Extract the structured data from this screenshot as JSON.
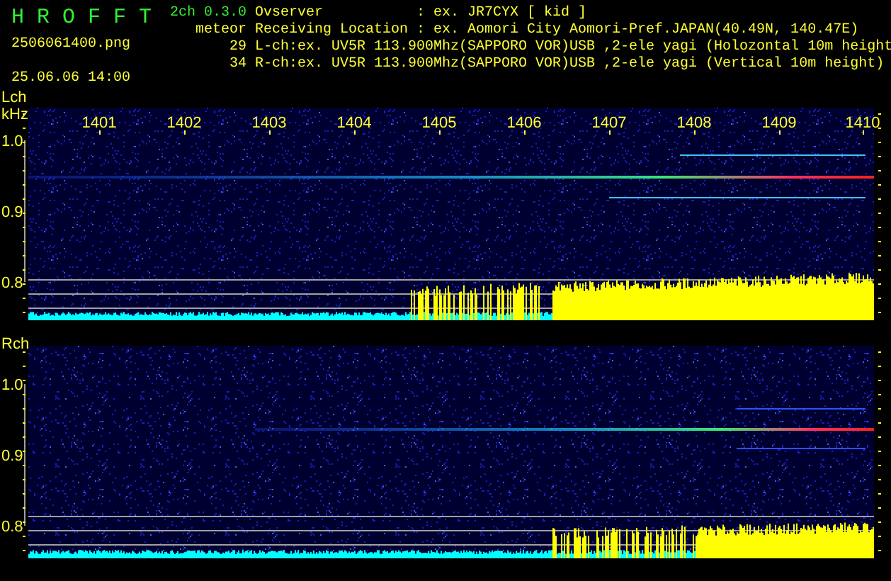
{
  "header": {
    "app_title": "H R O F F T",
    "version": "2ch 0.3.0",
    "filename": "2506061400.png",
    "datetime": "25.06.06 14:00",
    "meteor_label": "meteor",
    "meteor_counts": [
      "29",
      "34"
    ],
    "info_lines": [
      "Ovserver           : ex. JR7CYX [ kid ]",
      "Receiving Location : ex. Aomori City Aomori-Pref.JAPAN(40.49N, 140.47E)",
      "L-ch:ex. UV5R 113.900Mhz(SAPPORO VOR)USB ,2-ele yagi (Holozontal 10m height",
      "R-ch:ex. UV5R 113.900Mhz(SAPPORO VOR)USB ,2-ele yagi (Vertical 10m height)"
    ]
  },
  "panels": [
    {
      "channel": "Lch",
      "unit": "kHz",
      "time_labels": [
        "1401",
        "1402",
        "1403",
        "1404",
        "1405",
        "1406",
        "1407",
        "1408",
        "1409",
        "1410"
      ],
      "freq_labels": [
        "1.0",
        "0.9",
        "0.8"
      ]
    },
    {
      "channel": "Rch",
      "freq_labels": [
        "1.0",
        "0.9",
        "0.8"
      ]
    }
  ]
}
